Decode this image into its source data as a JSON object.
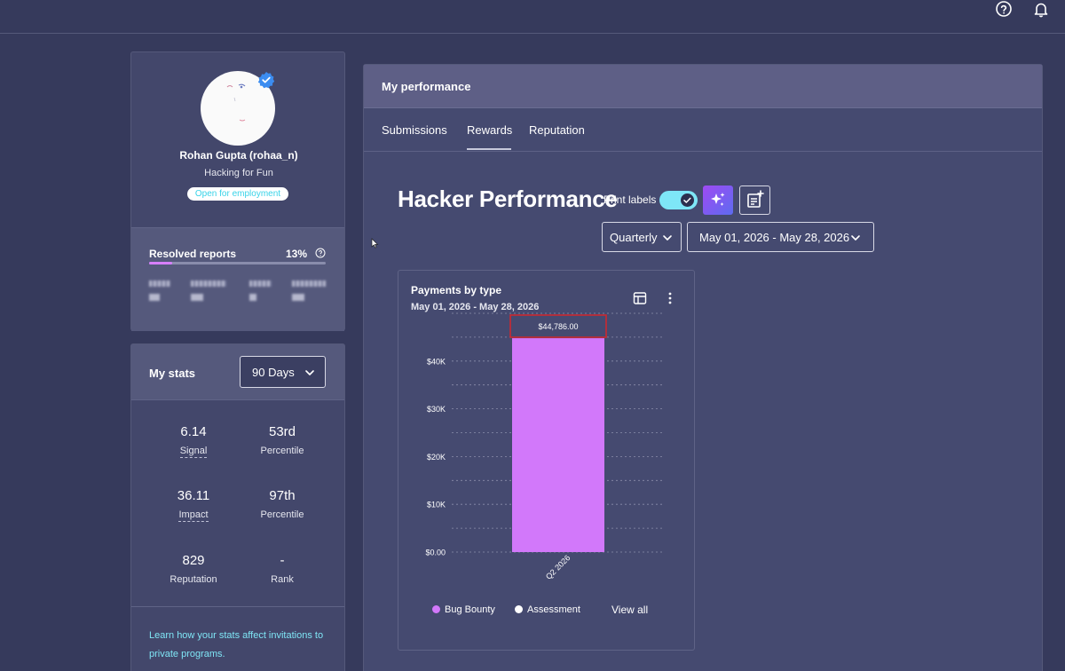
{
  "topbar": {
    "help_icon": "question-circle-icon",
    "bell_icon": "bell-icon"
  },
  "profile": {
    "name": "Rohan Gupta (rohaa_n)",
    "tagline": "Hacking for Fun",
    "badge": "Open for employment",
    "resolved_label": "Resolved reports",
    "resolved_percent": "13%",
    "resolved_fraction": 0.13,
    "accent": "#d77fff"
  },
  "stats": {
    "title": "My stats",
    "range": "90 Days",
    "items": [
      {
        "value": "6.14",
        "label": "Signal"
      },
      {
        "value": "53rd",
        "label": "Percentile"
      },
      {
        "value": "36.11",
        "label": "Impact"
      },
      {
        "value": "97th",
        "label": "Percentile"
      },
      {
        "value": "829",
        "label": "Reputation"
      },
      {
        "value": "-",
        "label": "Rank"
      }
    ],
    "footer": "Learn how your stats affect invitations to private programs."
  },
  "performance": {
    "title": "My performance",
    "tabs": [
      "Submissions",
      "Rewards",
      "Reputation"
    ],
    "active_tab": "Rewards",
    "heading": "Hacker Performance",
    "print_labels": "Print labels",
    "interval": "Quarterly",
    "date_range": "May 01, 2026 - May 28, 2026"
  },
  "chart_panel": {
    "title": "Payments by type",
    "subtitle": "May 01, 2026 - May 28, 2026",
    "view_all": "View all",
    "legend": [
      {
        "name": "Bug Bounty",
        "color": "#d278fa"
      },
      {
        "name": "Assessment",
        "color": "#ffffff"
      }
    ]
  },
  "chart_data": {
    "type": "bar",
    "categories": [
      "Q2 2026"
    ],
    "series": [
      {
        "name": "Bug Bounty",
        "values": [
          44786.0
        ],
        "color": "#d278fa"
      },
      {
        "name": "Assessment",
        "values": [
          0
        ]
      }
    ],
    "data_labels": [
      "$44,786.00"
    ],
    "y_ticks": [
      "$0.00",
      "$10K",
      "$20K",
      "$30K",
      "$40K"
    ],
    "ylim": [
      0,
      50000
    ],
    "grid": true,
    "legend_position": "bottom"
  }
}
